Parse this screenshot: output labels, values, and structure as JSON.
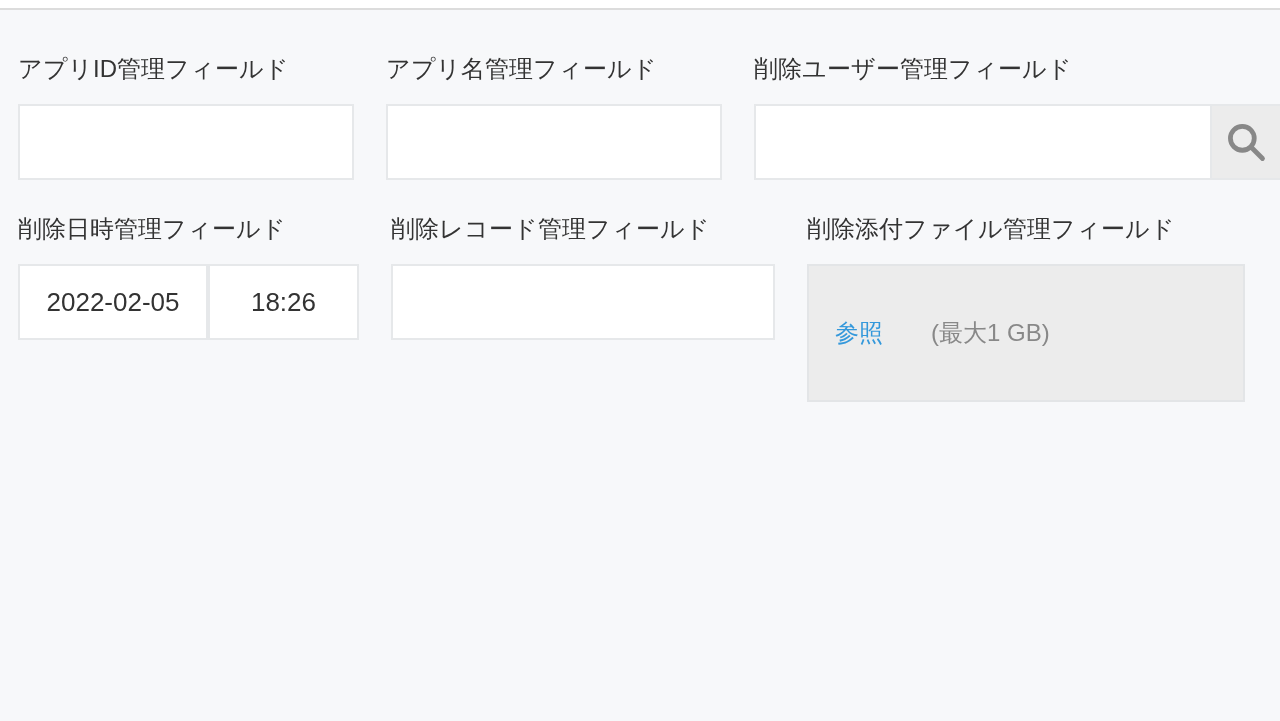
{
  "rows": [
    {
      "fields": [
        {
          "kind": "text",
          "label": "アプリID管理フィールド"
        },
        {
          "kind": "text",
          "label": "アプリ名管理フィールド"
        },
        {
          "kind": "lookup",
          "label": "削除ユーザー管理フィールド"
        }
      ]
    },
    {
      "fields": [
        {
          "kind": "datetime",
          "label": "削除日時管理フィールド",
          "date": "2022-02-05",
          "time": "18:26"
        },
        {
          "kind": "text",
          "label": "削除レコード管理フィールド"
        },
        {
          "kind": "file",
          "label": "削除添付ファイル管理フィールド",
          "link": "参照",
          "note": "(最大1 GB)"
        }
      ]
    }
  ]
}
